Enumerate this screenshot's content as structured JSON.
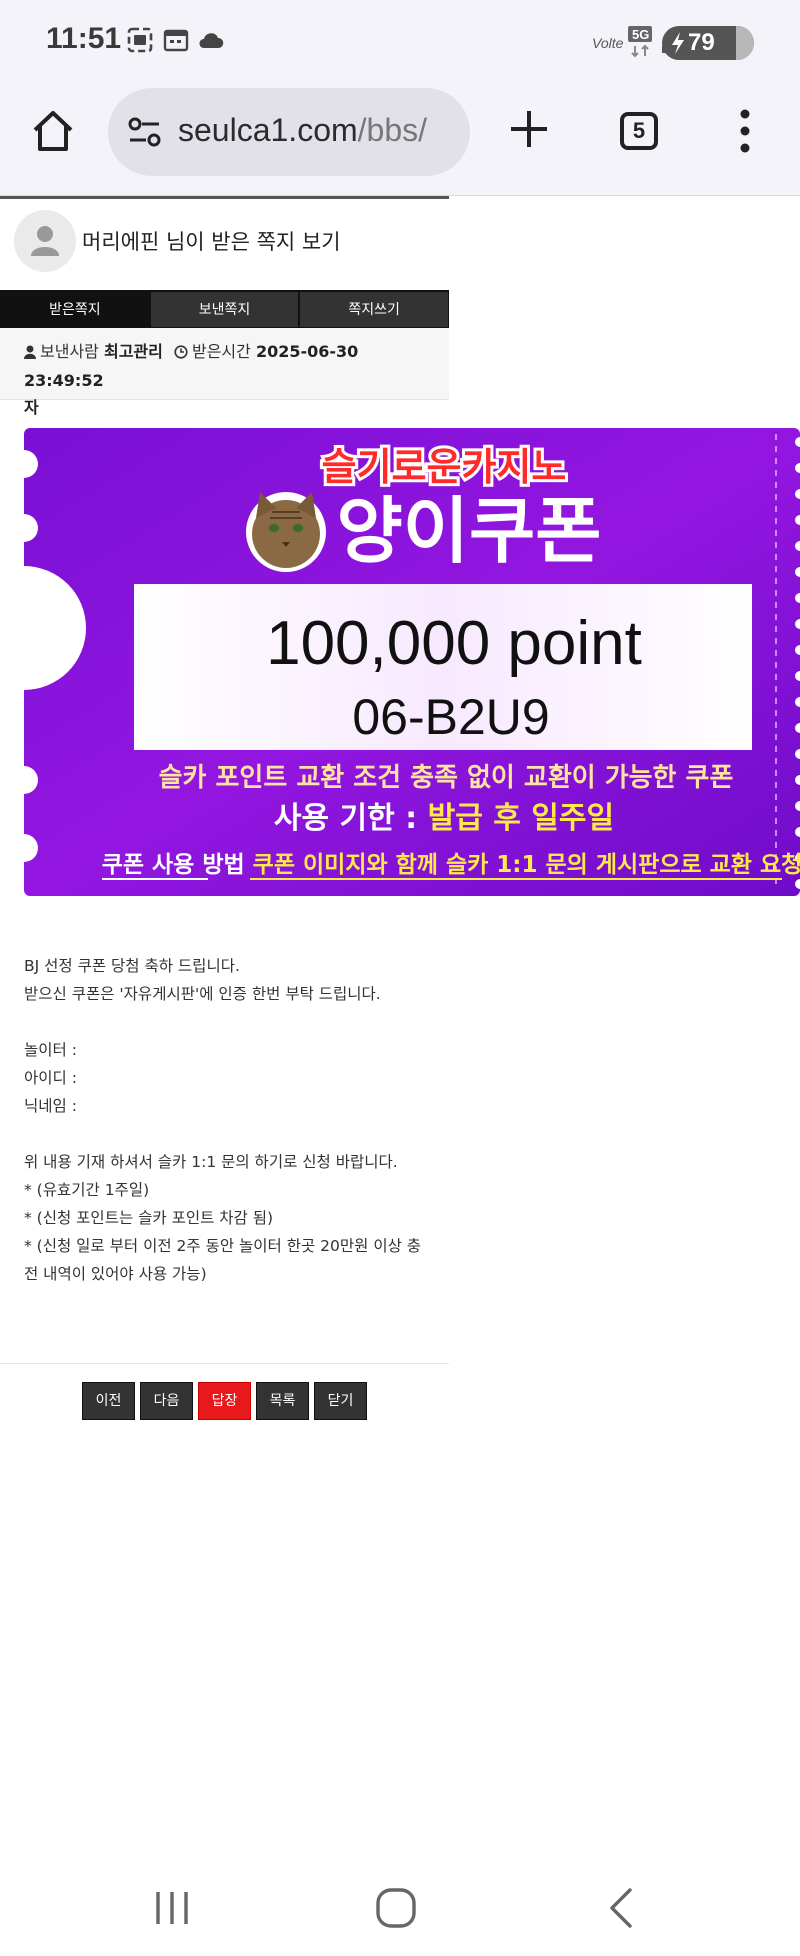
{
  "status_bar": {
    "time": "11:51",
    "network": "5G",
    "carrier": "Volte",
    "battery": "79",
    "icons": [
      "gallery-icon",
      "calendar-icon",
      "cloud-icon",
      "signal-icon"
    ]
  },
  "browser": {
    "url_main": "seulca1.com",
    "url_path": "/bbs/",
    "tab_count": "5",
    "icons": [
      "home-icon",
      "site-settings-icon",
      "new-tab-icon",
      "menu-dots-icon"
    ]
  },
  "page": {
    "title": "머리에핀 님이 받은 쪽지 보기",
    "tabs": [
      {
        "label": "받은쪽지"
      },
      {
        "label": "보낸쪽지"
      },
      {
        "label": "쪽지쓰기"
      }
    ],
    "meta": {
      "sender_label": "보낸사람",
      "sender": "최고관리",
      "received_label": "받은시간",
      "received_time": "2025-06-30 23:49:52",
      "overflow": "자"
    }
  },
  "coupon": {
    "brand": "슬기로운카지노",
    "name": "양이쿠폰",
    "amount": "100,000 point",
    "code": "06-B2U9",
    "line1": "슬카 포인트 교환 조건 충족 없이 교환이 가능한 쿠폰",
    "expiry_label": "사용 기한 : ",
    "expiry_value": "발급 후 일주일",
    "usage_label": "쿠폰 사용 방법",
    "usage_text": "쿠폰 이미지와 함께 슬카 1:1 문의 게시판으로 교환 요청",
    "colors": {
      "purple": "#8a12d6",
      "red": "#e8222a",
      "yellow": "#ffe94a"
    }
  },
  "message": {
    "lines": [
      "BJ 선정 쿠폰 당첨 축하 드립니다.",
      "받으신 쿠폰은 '자유게시판'에 인증 한번 부탁 드립니다.",
      "",
      "놀이터 :",
      "아이디 :",
      "닉네임 :",
      "",
      "위 내용 기재 하셔서 슬카 1:1 문의 하기로 신청 바랍니다.",
      "* (유효기간 1주일)",
      "* (신청 포인트는 슬카 포인트 차감 됨)",
      "* (신청 일로 부터 이전 2주 동안 놀이터 한곳 20만원 이상 충",
      "전 내역이 있어야 사용 가능)"
    ]
  },
  "buttons": {
    "prev": "이전",
    "next": "다음",
    "reply": "답장",
    "list": "목록",
    "close": "닫기"
  },
  "nav": {
    "icons": [
      "recent-apps-icon",
      "home-circle-icon",
      "back-icon"
    ]
  }
}
